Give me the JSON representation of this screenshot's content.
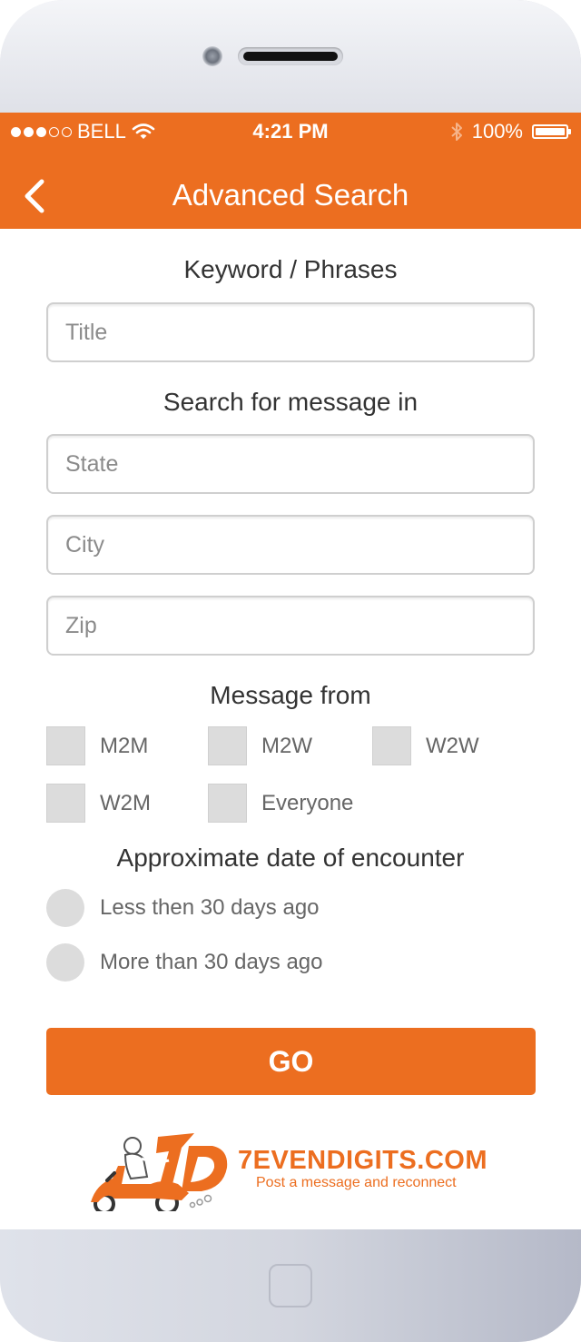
{
  "status_bar": {
    "carrier": "BELL",
    "signal_dots_filled": 3,
    "signal_dots_total": 5,
    "time": "4:21 PM",
    "battery": "100%",
    "icons": [
      "wifi-icon",
      "bluetooth-icon",
      "battery-icon"
    ]
  },
  "nav": {
    "title": "Advanced Search",
    "back_icon": "chevron-left-icon"
  },
  "keyword": {
    "heading": "Keyword / Phrases",
    "title_placeholder": "Title"
  },
  "location": {
    "heading": "Search for message in",
    "state_placeholder": "State",
    "city_placeholder": "City",
    "zip_placeholder": "Zip"
  },
  "message_from": {
    "heading": "Message from",
    "options": [
      "M2M",
      "M2W",
      "W2W",
      "W2M",
      "Everyone"
    ]
  },
  "date": {
    "heading": "Approximate date of encounter",
    "options": [
      "Less then 30 days ago",
      "More than 30 days ago"
    ]
  },
  "go_label": "GO",
  "branding": {
    "logo_mark": "7D",
    "name": "7EVENDIGITS.COM",
    "tagline": "Post a message and reconnect"
  },
  "colors": {
    "accent": "#ec6e20",
    "checkbox": "#dcdcdc"
  }
}
